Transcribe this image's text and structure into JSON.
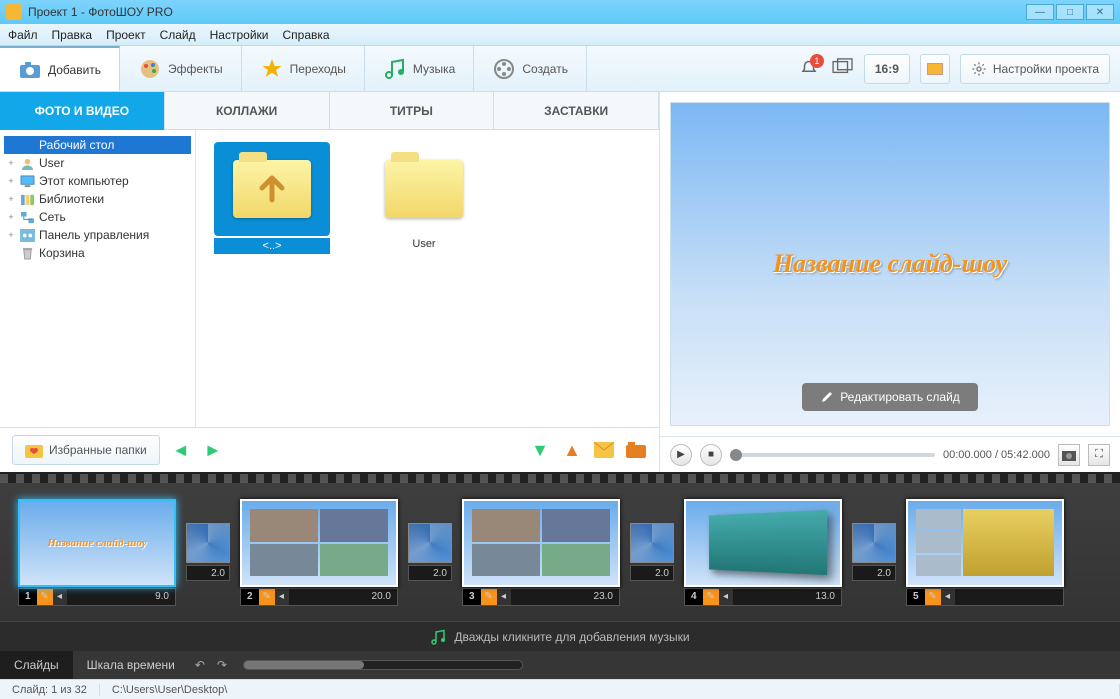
{
  "window": {
    "title": "Проект 1 - ФотоШОУ PRO"
  },
  "menu": [
    "Файл",
    "Правка",
    "Проект",
    "Слайд",
    "Настройки",
    "Справка"
  ],
  "toolbar": {
    "add": "Добавить",
    "effects": "Эффекты",
    "transitions": "Переходы",
    "music": "Музыка",
    "create": "Создать",
    "notif_count": "1",
    "aspect": "16:9",
    "settings": "Настройки проекта"
  },
  "tabs": {
    "photo_video": "ФОТО И ВИДЕО",
    "collages": "КОЛЛАЖИ",
    "titles": "ТИТРЫ",
    "intros": "ЗАСТАВКИ"
  },
  "tree": [
    {
      "label": "Рабочий стол",
      "selected": true,
      "exp": ""
    },
    {
      "label": "User",
      "exp": "+"
    },
    {
      "label": "Этот компьютер",
      "exp": "+"
    },
    {
      "label": "Библиотеки",
      "exp": "+"
    },
    {
      "label": "Сеть",
      "exp": "+"
    },
    {
      "label": "Панель управления",
      "exp": "+"
    },
    {
      "label": "Корзина",
      "exp": ""
    }
  ],
  "thumbs": {
    "up": "<..>",
    "user": "User"
  },
  "favorites": "Избранные папки",
  "preview": {
    "title_text": "Название слайд-шоу",
    "edit": "Редактировать слайд"
  },
  "player": {
    "time": "00:00.000 / 05:42.000"
  },
  "timeline": {
    "slides": [
      {
        "n": "1",
        "dur": "9.0"
      },
      {
        "n": "2",
        "dur": "20.0"
      },
      {
        "n": "3",
        "dur": "23.0"
      },
      {
        "n": "4",
        "dur": "13.0"
      },
      {
        "n": "5",
        "dur": ""
      }
    ],
    "trans_dur": "2.0",
    "music_hint": "Дважды кликните для добавления музыки"
  },
  "bottom_tabs": {
    "slides": "Слайды",
    "timeline": "Шкала времени"
  },
  "status": {
    "slide": "Слайд: 1 из 32",
    "path": "C:\\Users\\User\\Desktop\\"
  }
}
